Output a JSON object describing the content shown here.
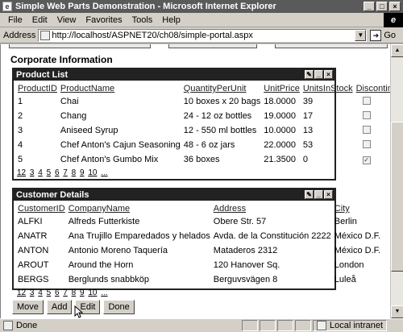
{
  "window": {
    "title": "Simple Web Parts Demonstration - Microsoft Internet Explorer"
  },
  "menu": [
    "File",
    "Edit",
    "View",
    "Favorites",
    "Tools",
    "Help"
  ],
  "address": {
    "label": "Address",
    "url": "http://localhost/ASPNET20/ch08/simple-portal.aspx",
    "go_label": "Go"
  },
  "page": {
    "section_title": "Corporate Information",
    "product_list": {
      "title": "Product List",
      "columns": [
        "ProductID",
        "ProductName",
        "QuantityPerUnit",
        "UnitPrice",
        "UnitsInStock",
        "Discontinued"
      ],
      "rows": [
        {
          "id": "1",
          "name": "Chai",
          "qty": "10 boxes x 20 bags",
          "price": "18.0000",
          "stock": "39",
          "disc": false
        },
        {
          "id": "2",
          "name": "Chang",
          "qty": "24 - 12 oz bottles",
          "price": "19.0000",
          "stock": "17",
          "disc": false
        },
        {
          "id": "3",
          "name": "Aniseed Syrup",
          "qty": "12 - 550 ml bottles",
          "price": "10.0000",
          "stock": "13",
          "disc": false
        },
        {
          "id": "4",
          "name": "Chef Anton's Cajun Seasoning",
          "qty": "48 - 6 oz jars",
          "price": "22.0000",
          "stock": "53",
          "disc": false
        },
        {
          "id": "5",
          "name": "Chef Anton's Gumbo Mix",
          "qty": "36 boxes",
          "price": "21.3500",
          "stock": "0",
          "disc": true
        }
      ],
      "pager": [
        "12",
        "3",
        "4",
        "5",
        "6",
        "7",
        "8",
        "9",
        "10",
        "..."
      ]
    },
    "customer_details": {
      "title": "Customer Details",
      "columns": [
        "CustomerID",
        "CompanyName",
        "Address",
        "City"
      ],
      "rows": [
        {
          "id": "ALFKI",
          "company": "Alfreds Futterkiste",
          "address": "Obere Str. 57",
          "city": "Berlin"
        },
        {
          "id": "ANATR",
          "company": "Ana Trujillo Emparedados y helados",
          "address": "Avda. de la Constitución 2222",
          "city": "México D.F."
        },
        {
          "id": "ANTON",
          "company": "Antonio Moreno Taquería",
          "address": "Mataderos 2312",
          "city": "México D.F."
        },
        {
          "id": "AROUT",
          "company": "Around the Horn",
          "address": "120 Hanover Sq.",
          "city": "London"
        },
        {
          "id": "BERGS",
          "company": "Berglunds snabbköp",
          "address": "Berguvsvägen 8",
          "city": "Luleå"
        }
      ],
      "pager": [
        "12",
        "3",
        "4",
        "5",
        "6",
        "7",
        "8",
        "9",
        "10",
        "..."
      ]
    },
    "buttons": {
      "move": "Move",
      "add": "Add",
      "edit": "Edit",
      "done": "Done"
    }
  },
  "status": {
    "text": "Done",
    "zone": "Local intranet"
  },
  "icons": {
    "app": "ie-page-icon",
    "edit": "pencil-icon",
    "minimize": "minimize-icon",
    "close": "close-icon"
  }
}
